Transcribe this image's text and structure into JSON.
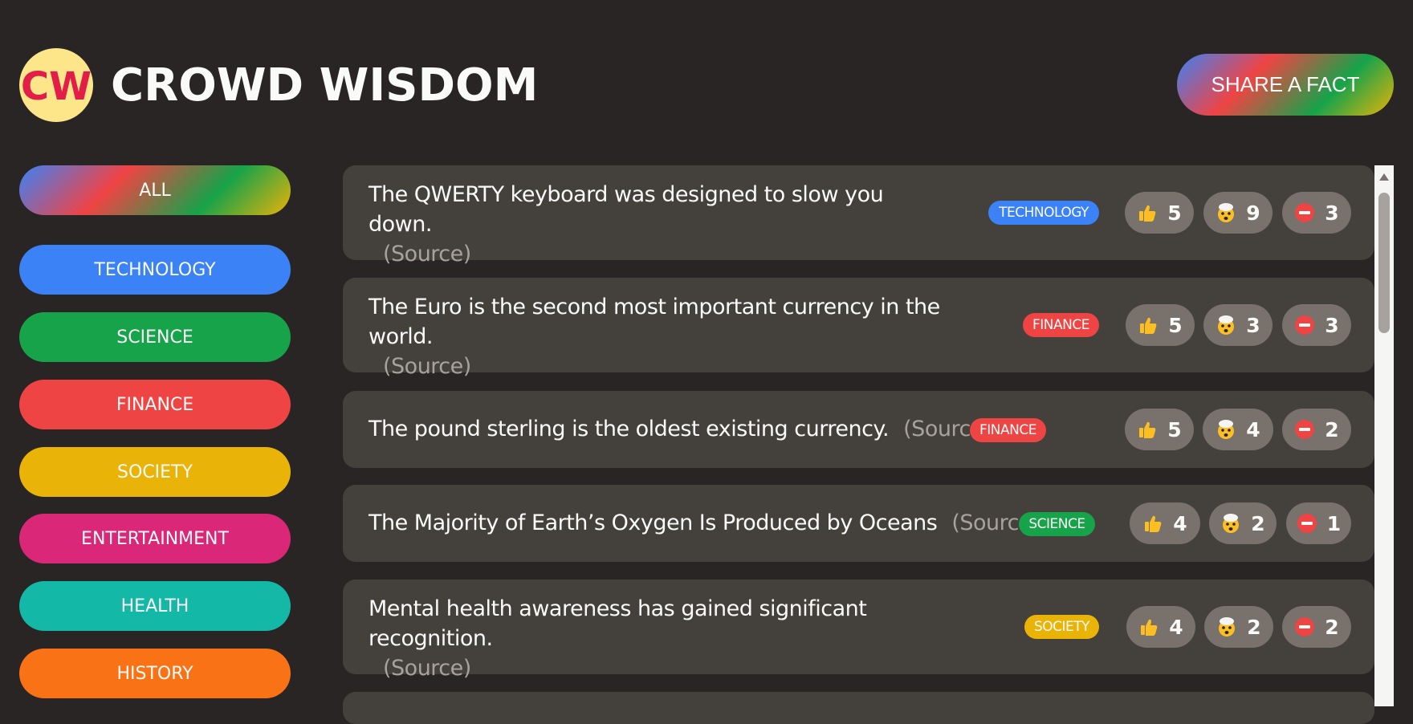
{
  "app": {
    "logo_text": "CW",
    "title": "CROWD WISDOM",
    "share_label": "SHARE A FACT"
  },
  "sidebar": {
    "items": [
      {
        "label": "ALL",
        "color": "gradient"
      },
      {
        "label": "TECHNOLOGY",
        "color": "#3b82f6"
      },
      {
        "label": "SCIENCE",
        "color": "#16a34a"
      },
      {
        "label": "FINANCE",
        "color": "#ef4444"
      },
      {
        "label": "SOCIETY",
        "color": "#eab308"
      },
      {
        "label": "ENTERTAINMENT",
        "color": "#db2777"
      },
      {
        "label": "HEALTH",
        "color": "#14b8a6"
      },
      {
        "label": "HISTORY",
        "color": "#f97316"
      }
    ]
  },
  "facts": [
    {
      "text": "The QWERTY keyboard was designed to slow you down.",
      "source": "(Source)",
      "tag": "TECHNOLOGY",
      "tag_color": "#3b82f6",
      "votes": {
        "interesting": "5",
        "mindblowing": "9",
        "false": "3"
      }
    },
    {
      "text": "The Euro is the second most important currency in the world.",
      "source": "(Source)",
      "tag": "FINANCE",
      "tag_color": "#ef4444",
      "votes": {
        "interesting": "5",
        "mindblowing": "3",
        "false": "3"
      }
    },
    {
      "text": "The pound sterling is the oldest existing currency.",
      "source": "(Source)",
      "tag": "FINANCE",
      "tag_color": "#ef4444",
      "votes": {
        "interesting": "5",
        "mindblowing": "4",
        "false": "2"
      }
    },
    {
      "text": "The Majority of Earth’s Oxygen Is Produced by Oceans",
      "source": "(Source)",
      "tag": "SCIENCE",
      "tag_color": "#16a34a",
      "votes": {
        "interesting": "4",
        "mindblowing": "2",
        "false": "1"
      }
    },
    {
      "text": "Mental health awareness has gained significant recognition.",
      "source": "(Source)",
      "tag": "SOCIETY",
      "tag_color": "#eab308",
      "votes": {
        "interesting": "4",
        "mindblowing": "2",
        "false": "2"
      }
    }
  ],
  "icons": {
    "interesting": "thumbs-up-icon",
    "mindblowing": "exploding-head-icon",
    "false": "no-entry-icon"
  }
}
